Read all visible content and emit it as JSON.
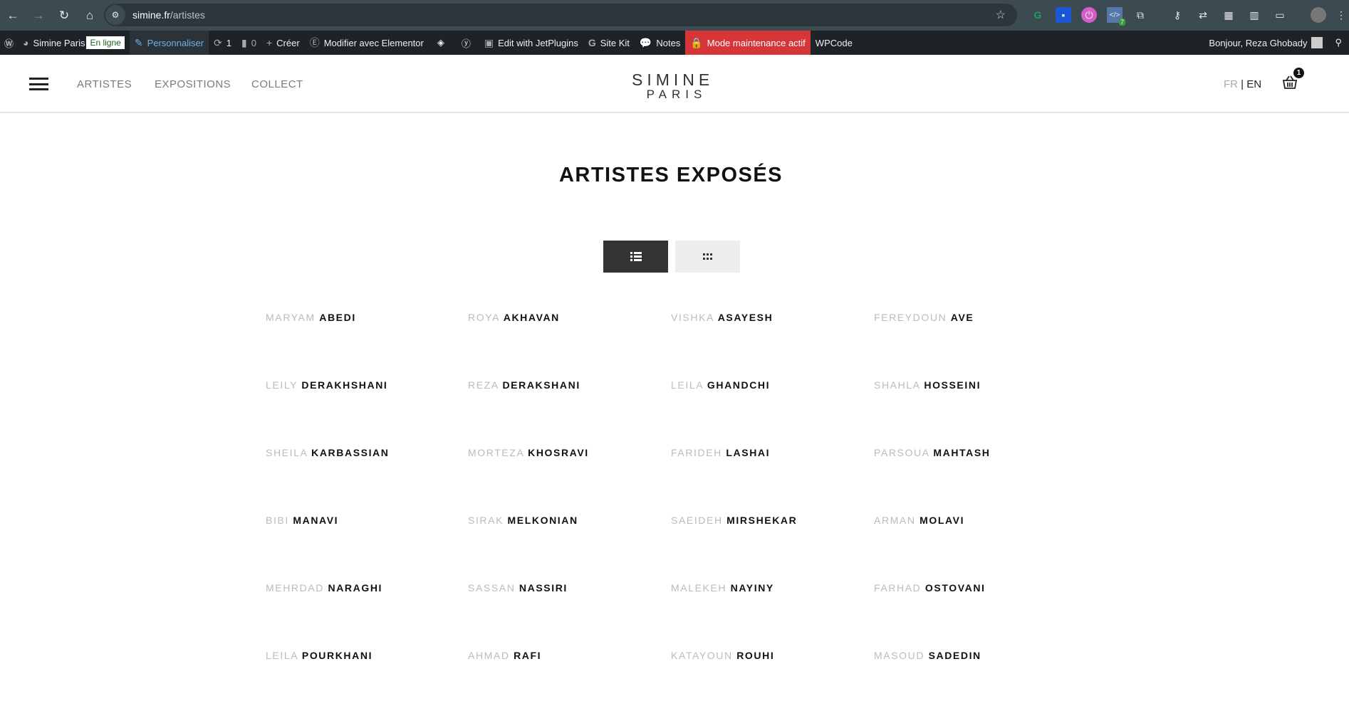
{
  "browser": {
    "url_host": "simine.fr",
    "url_path": "/artistes",
    "extension_badge": "7"
  },
  "admin_bar": {
    "site": "Simine Paris",
    "status": "En ligne",
    "customize": "Personnaliser",
    "updates": "1",
    "comments": "0",
    "new": "Créer",
    "elementor": "Modifier avec Elementor",
    "jet": "Edit with JetPlugins",
    "sitekit": "Site Kit",
    "notes": "Notes",
    "maintenance": "Mode maintenance actif",
    "wpcode": "WPCode",
    "greeting": "Bonjour, Reza Ghobady"
  },
  "header": {
    "nav": [
      "ARTISTES",
      "EXPOSITIONS",
      "COLLECT"
    ],
    "logo_line1": "SIMINE",
    "logo_line2": "PARIS",
    "lang_fr": "FR",
    "lang_sep": " | ",
    "lang_en": "EN",
    "cart_count": "1"
  },
  "page": {
    "title": "ARTISTES EXPOSÉS"
  },
  "artists": [
    [
      "MARYAM",
      "ABEDI"
    ],
    [
      "ROYA",
      "AKHAVAN"
    ],
    [
      "VISHKA",
      "ASAYESH"
    ],
    [
      "FEREYDOUN",
      "AVE"
    ],
    [
      "LEILY",
      "DERAKHSHANI"
    ],
    [
      "REZA",
      "DERAKSHANI"
    ],
    [
      "LEILA",
      "GHANDCHI"
    ],
    [
      "SHAHLA",
      "HOSSEINI"
    ],
    [
      "SHEILA",
      "KARBASSIAN"
    ],
    [
      "MORTEZA",
      "KHOSRAVI"
    ],
    [
      "FARIDEH",
      "LASHAI"
    ],
    [
      "PARSOUA",
      "MAHTASH"
    ],
    [
      "BIBI",
      "MANAVI"
    ],
    [
      "SIRAK",
      "MELKONIAN"
    ],
    [
      "SAEIDEH",
      "MIRSHEKAR"
    ],
    [
      "ARMAN",
      "MOLAVI"
    ],
    [
      "MEHRDAD",
      "NARAGHI"
    ],
    [
      "SASSAN",
      "NASSIRI"
    ],
    [
      "MALEKEH",
      "NAYINY"
    ],
    [
      "FARHAD",
      "OSTOVANI"
    ],
    [
      "LEILA",
      "POURKHANI"
    ],
    [
      "AHMAD",
      "RAFI"
    ],
    [
      "KATAYOUN",
      "ROUHI"
    ],
    [
      "MASOUD",
      "SADEDIN"
    ]
  ]
}
